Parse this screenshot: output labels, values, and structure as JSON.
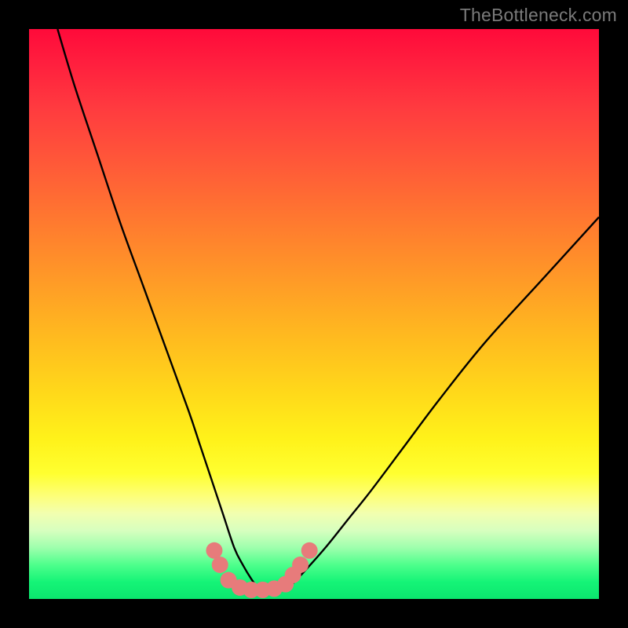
{
  "watermark": "TheBottleneck.com",
  "chart_data": {
    "type": "line",
    "title": "",
    "xlabel": "",
    "ylabel": "",
    "xlim": [
      0,
      100
    ],
    "ylim": [
      0,
      100
    ],
    "grid": false,
    "legend": false,
    "series": [
      {
        "name": "bottleneck-curve",
        "color": "#000000",
        "x": [
          5,
          8,
          12,
          16,
          20,
          24,
          28,
          30,
          32,
          34,
          36,
          37.5,
          39,
          40,
          41,
          42,
          44,
          46,
          48,
          52,
          56,
          60,
          66,
          72,
          80,
          90,
          100
        ],
        "y": [
          100,
          90,
          78,
          66,
          55,
          44,
          33,
          27,
          21,
          15,
          9,
          6,
          3.5,
          2.2,
          1.5,
          1.3,
          1.5,
          2.5,
          4.5,
          9,
          14,
          19,
          27,
          35,
          45,
          56,
          67
        ]
      },
      {
        "name": "highlight-dots",
        "color": "#e77b7b",
        "type": "scatter",
        "x": [
          32.5,
          33.5,
          35.0,
          37.0,
          39.0,
          41.0,
          43.0,
          45.0,
          46.3,
          47.6,
          49.2
        ],
        "y": [
          8.5,
          6.0,
          3.3,
          2.0,
          1.6,
          1.6,
          1.8,
          2.6,
          4.2,
          6.0,
          8.5
        ]
      }
    ],
    "gradient_stops": [
      {
        "pos": 0.0,
        "color": "#ff0a3a"
      },
      {
        "pos": 0.5,
        "color": "#ffba1f"
      },
      {
        "pos": 0.78,
        "color": "#ffff30"
      },
      {
        "pos": 1.0,
        "color": "#0be66e"
      }
    ]
  }
}
